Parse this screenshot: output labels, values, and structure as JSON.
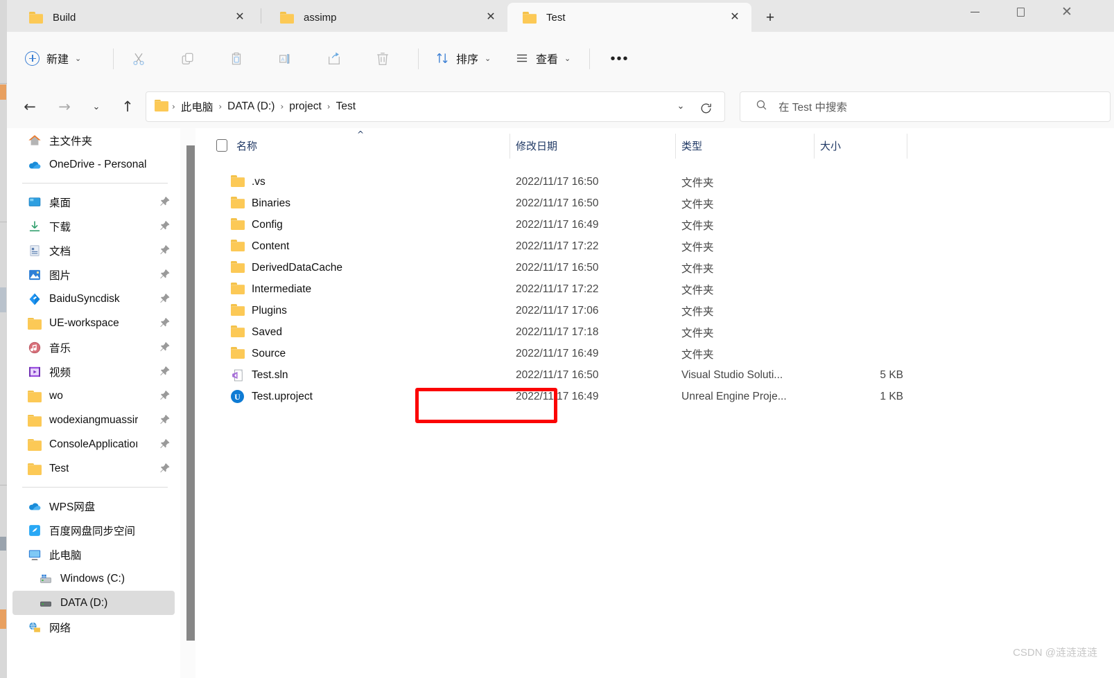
{
  "window": {
    "minimize_label": "—",
    "maximize_label": "▢",
    "close_label": "✕"
  },
  "tabs": {
    "items": [
      {
        "label": "Build",
        "icon": "folder-icon",
        "close": "✕",
        "active": false
      },
      {
        "label": "assimp",
        "icon": "folder-icon",
        "close": "✕",
        "active": false
      },
      {
        "label": "Test",
        "icon": "folder-icon",
        "close": "✕",
        "active": true
      }
    ],
    "new_tab_label": "+"
  },
  "toolbar": {
    "new_label": "新建",
    "new_chevron": "⌄",
    "cut_name": "cut-icon",
    "copy_name": "copy-icon",
    "paste_name": "paste-icon",
    "rename_name": "rename-icon",
    "share_name": "share-icon",
    "delete_name": "delete-icon",
    "sort_label": "排序",
    "sort_chevron": "⌄",
    "view_label": "查看",
    "view_chevron": "⌄",
    "more_label": "•••"
  },
  "nav": {
    "back": "←",
    "forward": "→",
    "recent": "⌄",
    "up": "↑"
  },
  "address": {
    "crumbs": [
      "此电脑",
      "DATA (D:)",
      "project",
      "Test"
    ],
    "separator": "›",
    "dropdown": "⌄"
  },
  "search": {
    "placeholder": "在 Test 中搜索"
  },
  "sidebar": {
    "items": [
      {
        "label": "主文件夹",
        "icon": "home-icon",
        "pinned": false,
        "indent": false,
        "selected": false
      },
      {
        "label": "OneDrive - Personal",
        "icon": "onedrive-icon",
        "pinned": false,
        "indent": false,
        "selected": false
      },
      {
        "divider": true
      },
      {
        "label": "桌面",
        "icon": "desktop-icon",
        "pinned": true,
        "indent": false,
        "selected": false
      },
      {
        "label": "下载",
        "icon": "downloads-icon",
        "pinned": true,
        "indent": false,
        "selected": false
      },
      {
        "label": "文档",
        "icon": "documents-icon",
        "pinned": true,
        "indent": false,
        "selected": false
      },
      {
        "label": "图片",
        "icon": "pictures-icon",
        "pinned": true,
        "indent": false,
        "selected": false
      },
      {
        "label": "BaiduSyncdisk",
        "icon": "baidu-sync-icon",
        "pinned": true,
        "indent": false,
        "selected": false
      },
      {
        "label": "UE-workspace",
        "icon": "folder-icon",
        "pinned": true,
        "indent": false,
        "selected": false
      },
      {
        "label": "音乐",
        "icon": "music-icon",
        "pinned": true,
        "indent": false,
        "selected": false
      },
      {
        "label": "视频",
        "icon": "videos-icon",
        "pinned": true,
        "indent": false,
        "selected": false
      },
      {
        "label": "wo",
        "icon": "folder-icon",
        "pinned": true,
        "indent": false,
        "selected": false
      },
      {
        "label": "wodexiangmuassir",
        "icon": "folder-icon",
        "pinned": true,
        "indent": false,
        "selected": false
      },
      {
        "label": "ConsoleApplicatioı",
        "icon": "folder-icon",
        "pinned": true,
        "indent": false,
        "selected": false
      },
      {
        "label": "Test",
        "icon": "folder-icon",
        "pinned": true,
        "indent": false,
        "selected": false
      },
      {
        "divider": true
      },
      {
        "label": "WPS网盘",
        "icon": "wps-cloud-icon",
        "pinned": false,
        "indent": false,
        "selected": false
      },
      {
        "label": "百度网盘同步空间",
        "icon": "baidu-cloud-icon",
        "pinned": false,
        "indent": false,
        "selected": false
      },
      {
        "label": "此电脑",
        "icon": "this-pc-icon",
        "pinned": false,
        "indent": false,
        "selected": false
      },
      {
        "label": "Windows (C:)",
        "icon": "os-drive-icon",
        "pinned": false,
        "indent": true,
        "selected": false
      },
      {
        "label": "DATA (D:)",
        "icon": "drive-icon",
        "pinned": false,
        "indent": true,
        "selected": true
      },
      {
        "label": "网络",
        "icon": "network-icon",
        "pinned": false,
        "indent": false,
        "selected": false
      }
    ]
  },
  "filelist": {
    "columns": [
      "名称",
      "修改日期",
      "类型",
      "大小"
    ],
    "sort_indicator": "^",
    "rows": [
      {
        "name": ".vs",
        "date": "2022/11/17 16:50",
        "type": "文件夹",
        "size": "",
        "icon": "folder-icon"
      },
      {
        "name": "Binaries",
        "date": "2022/11/17 16:50",
        "type": "文件夹",
        "size": "",
        "icon": "folder-icon"
      },
      {
        "name": "Config",
        "date": "2022/11/17 16:49",
        "type": "文件夹",
        "size": "",
        "icon": "folder-icon"
      },
      {
        "name": "Content",
        "date": "2022/11/17 17:22",
        "type": "文件夹",
        "size": "",
        "icon": "folder-icon"
      },
      {
        "name": "DerivedDataCache",
        "date": "2022/11/17 16:50",
        "type": "文件夹",
        "size": "",
        "icon": "folder-icon"
      },
      {
        "name": "Intermediate",
        "date": "2022/11/17 17:22",
        "type": "文件夹",
        "size": "",
        "icon": "folder-icon"
      },
      {
        "name": "Plugins",
        "date": "2022/11/17 17:06",
        "type": "文件夹",
        "size": "",
        "icon": "folder-icon"
      },
      {
        "name": "Saved",
        "date": "2022/11/17 17:18",
        "type": "文件夹",
        "size": "",
        "icon": "folder-icon"
      },
      {
        "name": "Source",
        "date": "2022/11/17 16:49",
        "type": "文件夹",
        "size": "",
        "icon": "folder-icon"
      },
      {
        "name": "Test.sln",
        "date": "2022/11/17 16:50",
        "type": "Visual Studio Soluti...",
        "size": "5 KB",
        "icon": "visual-studio-icon"
      },
      {
        "name": "Test.uproject",
        "date": "2022/11/17 16:49",
        "type": "Unreal Engine Proje...",
        "size": "1 KB",
        "icon": "unreal-engine-icon"
      }
    ]
  },
  "annotation": {
    "highlight_color": "#fb0404",
    "highlights_row": "Test.uproject"
  },
  "watermark": {
    "text": "CSDN @涟涟涟涟"
  }
}
